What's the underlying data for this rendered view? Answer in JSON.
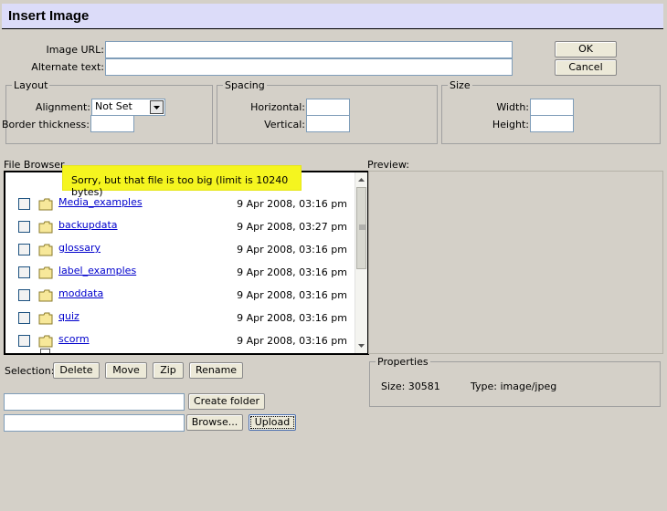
{
  "dialog": {
    "title": "Insert Image"
  },
  "fields": {
    "image_url_label": "Image URL:",
    "image_url_value": "",
    "alt_text_label": "Alternate text:",
    "alt_text_value": ""
  },
  "buttons": {
    "ok": "OK",
    "cancel": "Cancel"
  },
  "layout": {
    "legend": "Layout",
    "alignment_label": "Alignment:",
    "alignment_value": "Not Set",
    "border_label": "Border thickness:",
    "border_value": ""
  },
  "spacing": {
    "legend": "Spacing",
    "horizontal_label": "Horizontal:",
    "horizontal_value": "",
    "vertical_label": "Vertical:",
    "vertical_value": ""
  },
  "size": {
    "legend": "Size",
    "width_label": "Width:",
    "width_value": "",
    "height_label": "Height:",
    "height_value": ""
  },
  "file_browser": {
    "label": "File Browser",
    "alert": "Sorry, but that file is too big (limit is 10240 bytes)",
    "items": [
      {
        "name": "Media_examples",
        "date": "9 Apr 2008, 03:16 pm"
      },
      {
        "name": "backupdata",
        "date": "9 Apr 2008, 03:27 pm"
      },
      {
        "name": "glossary",
        "date": "9 Apr 2008, 03:16 pm"
      },
      {
        "name": "label_examples",
        "date": "9 Apr 2008, 03:16 pm"
      },
      {
        "name": "moddata",
        "date": "9 Apr 2008, 03:16 pm"
      },
      {
        "name": "quiz",
        "date": "9 Apr 2008, 03:16 pm"
      },
      {
        "name": "scorm",
        "date": "9 Apr 2008, 03:16 pm"
      }
    ]
  },
  "preview": {
    "label": "Preview:"
  },
  "selection": {
    "label": "Selection:",
    "delete": "Delete",
    "move": "Move",
    "zip": "Zip",
    "rename": "Rename"
  },
  "properties": {
    "legend": "Properties",
    "size_text": "Size: 30581",
    "type_text": "Type: image/jpeg"
  },
  "folder_create": {
    "value": "",
    "button": "Create folder"
  },
  "upload": {
    "file_value": "",
    "browse": "Browse...",
    "upload": "Upload"
  }
}
